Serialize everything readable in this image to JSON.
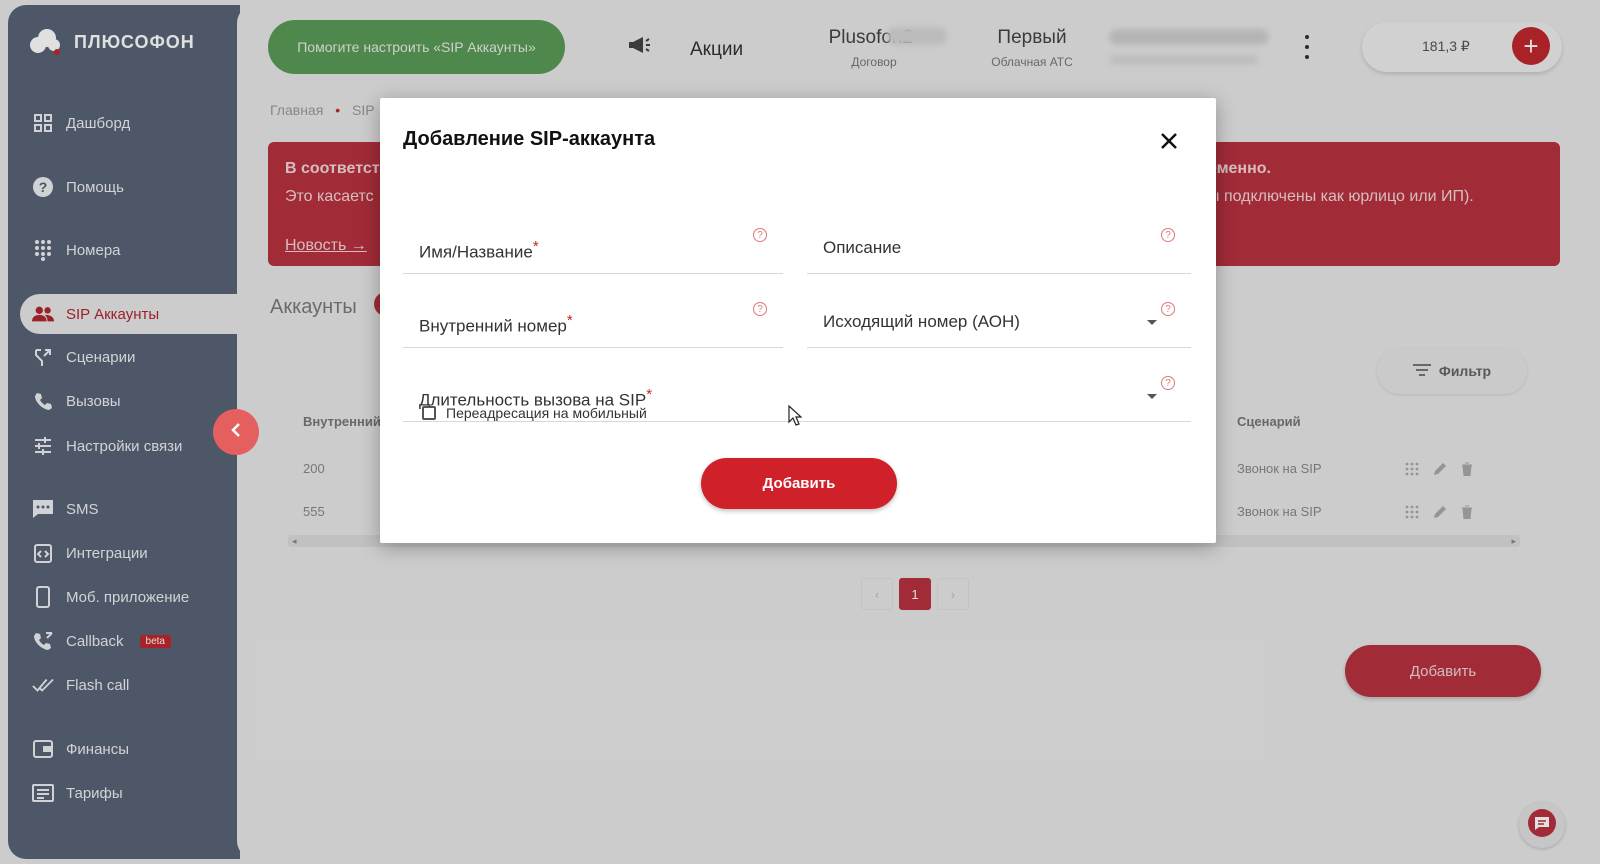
{
  "brand": {
    "name": "ПЛЮСОФОН"
  },
  "sidebar": {
    "items": [
      {
        "label": "Дашборд",
        "icon": "dashboard-icon"
      },
      {
        "label": "Помощь",
        "icon": "help-icon"
      },
      {
        "label": "Номера",
        "icon": "dialpad-icon"
      },
      {
        "label": "SIP Аккаунты",
        "icon": "people-icon",
        "active": true
      },
      {
        "label": "Сценарии",
        "icon": "route-icon"
      },
      {
        "label": "Вызовы",
        "icon": "phone-icon"
      },
      {
        "label": "Настройки связи",
        "icon": "sliders-icon"
      },
      {
        "label": "SMS",
        "icon": "sms-icon"
      },
      {
        "label": "Интеграции",
        "icon": "integration-icon"
      },
      {
        "label": "Моб. приложение",
        "icon": "mobile-icon"
      },
      {
        "label": "Callback",
        "icon": "callback-icon",
        "badge": "beta"
      },
      {
        "label": "Flash call",
        "icon": "check-icon"
      },
      {
        "label": "Финансы",
        "icon": "wallet-icon"
      },
      {
        "label": "Тарифы",
        "icon": "tariff-icon"
      }
    ]
  },
  "topbar": {
    "help_button": "Помогите настроить «SIP Аккаунты»",
    "promo": "Акции",
    "account_name": "Plusofon2-",
    "account_sub": "Договор",
    "pbx_name": "Первый",
    "pbx_sub": "Облачная АТС",
    "balance": "181,3 ₽"
  },
  "breadcrumb": {
    "home": "Главная",
    "current": "SIP"
  },
  "banner": {
    "line1_left": "В соответст",
    "line2_left": "Это касаетс",
    "line1_right": "еменно.",
    "line2_right": "ы подключены как юрлицо или ИП).",
    "link": "Новость →"
  },
  "section": {
    "title": "Аккаунты"
  },
  "table": {
    "filter_label": "Фильтр",
    "headers": {
      "internal": "Внутренний",
      "scenario": "Сценарий"
    },
    "rows": [
      {
        "internal": "200",
        "scenario": "Звонок на SIP"
      },
      {
        "internal": "555",
        "scenario": "Звонок на SIP"
      }
    ]
  },
  "pagination": {
    "prev": "‹",
    "current": "1",
    "next": "›"
  },
  "add_button": "Добавить",
  "modal": {
    "title": "Добавление SIP-аккаунта",
    "fields": {
      "name": "Имя/Название",
      "description": "Описание",
      "internal_number": "Внутренний номер",
      "outgoing_number": "Исходящий номер (АОН)",
      "duration": "Длительность вызова на SIP"
    },
    "required_mark": "*",
    "help_mark": "?",
    "checkbox_label": "Переадресация на мобильный",
    "submit": "Добавить"
  },
  "colors": {
    "accent": "#c1272d",
    "sidebar": "#586476",
    "help_green": "#5b9b57"
  }
}
